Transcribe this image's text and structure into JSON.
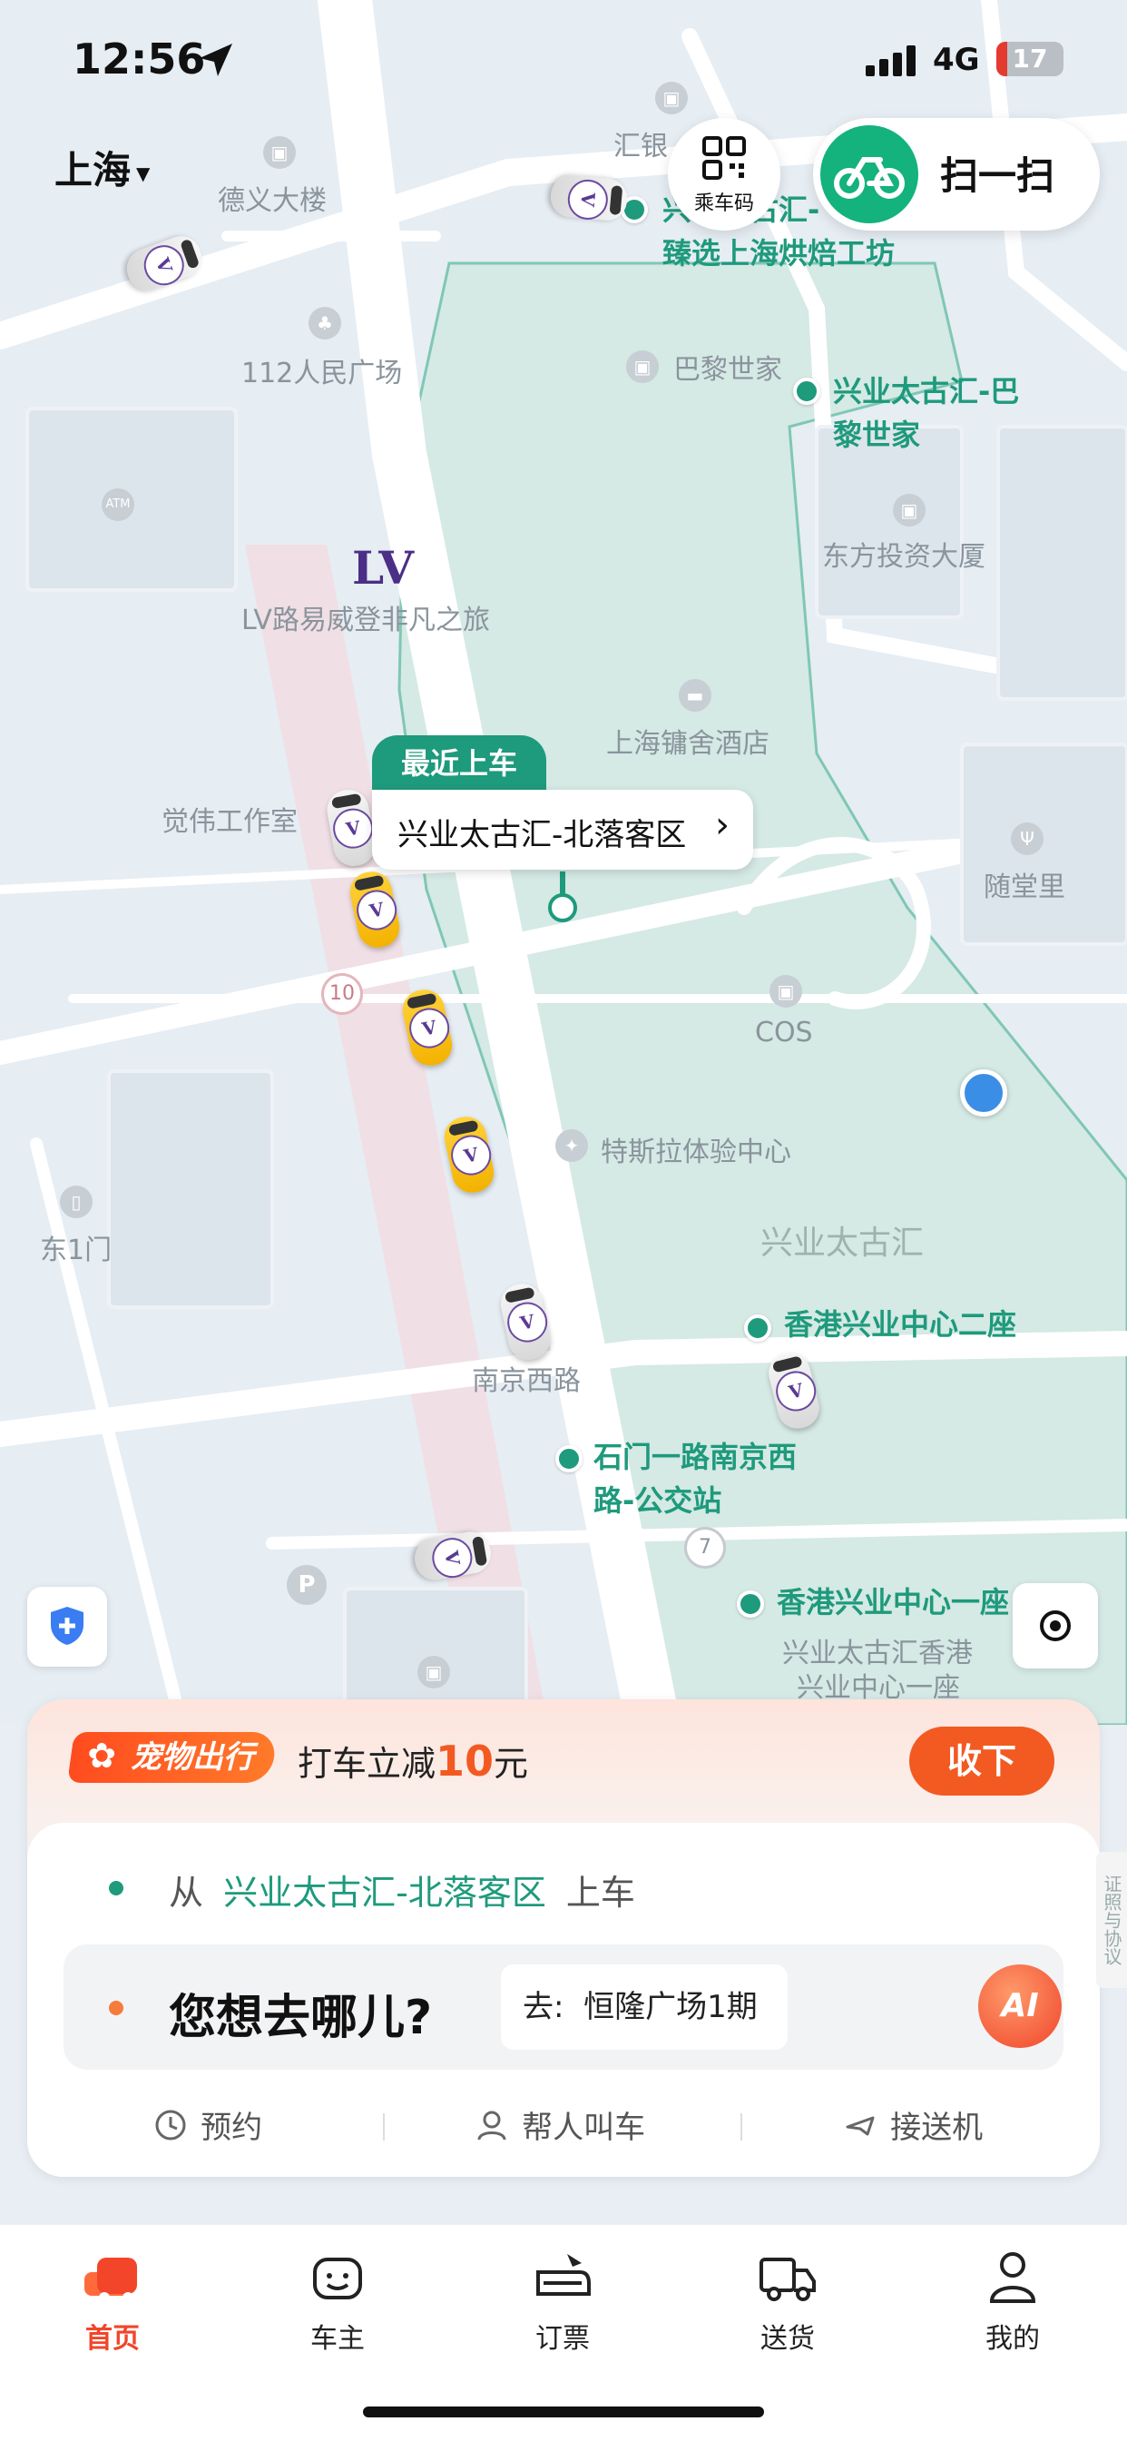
{
  "status_bar": {
    "time": "12:56",
    "network": "4G",
    "battery": "17"
  },
  "header": {
    "city": "上海",
    "qr_label": "乘车码",
    "scan_label": "扫一扫"
  },
  "map": {
    "pois": [
      {
        "name": "德义大楼"
      },
      {
        "name": "汇银"
      },
      {
        "name": "112人民广场"
      },
      {
        "name": "巴黎世家"
      },
      {
        "name": "东方投资大厦"
      },
      {
        "name": "LV路易威登非凡之旅"
      },
      {
        "name": "上海镛舍酒店"
      },
      {
        "name": "觉伟工作室"
      },
      {
        "name": "随堂里"
      },
      {
        "name": "COS"
      },
      {
        "name": "特斯拉体验中心"
      },
      {
        "name": "兴业太古汇"
      },
      {
        "name": "东1门"
      },
      {
        "name": "南京西路"
      },
      {
        "name": "兴业太古汇香港"
      },
      {
        "name": "兴业中心一座"
      }
    ],
    "green_pois": [
      {
        "name": "兴业太古汇-"
      },
      {
        "name": "臻选上海烘焙工坊"
      },
      {
        "name": "兴业太古汇-巴"
      },
      {
        "name": "黎世家"
      },
      {
        "name": "香港兴业中心二座"
      },
      {
        "name": "石门一路南京西"
      },
      {
        "name": "路-公交站"
      },
      {
        "name": "香港兴业中心一座"
      }
    ],
    "road_badges": [
      "10",
      "7"
    ],
    "pickup_tag": "最近上车",
    "pickup_name": "兴业太古汇-北落客区",
    "pickup_chevron": "›",
    "brand_logo": "LV"
  },
  "promo": {
    "badge": "宠物出行",
    "text_prefix": "打车立减",
    "amount": "10",
    "text_suffix": "元",
    "button": "收下"
  },
  "ride": {
    "from_prefix": "从",
    "from_place": "兴业太古汇-北落客区",
    "from_suffix": "上车",
    "dest_prompt": "您想去哪儿?",
    "suggest": "去:  恒隆广场1期",
    "ai_label": "AI",
    "side_tab": "证照与协议"
  },
  "quick": [
    {
      "label": "预约",
      "icon": "clock-icon"
    },
    {
      "label": "帮人叫车",
      "icon": "person-icon"
    },
    {
      "label": "接送机",
      "icon": "plane-icon"
    }
  ],
  "nav": [
    {
      "label": "首页",
      "icon": "home-car-icon",
      "active": true
    },
    {
      "label": "车主",
      "icon": "driver-face-icon",
      "active": false
    },
    {
      "label": "订票",
      "icon": "train-ticket-icon",
      "active": false
    },
    {
      "label": "送货",
      "icon": "truck-icon",
      "active": false
    },
    {
      "label": "我的",
      "icon": "profile-icon",
      "active": false
    }
  ],
  "colors": {
    "brand_green": "#1e9a7c",
    "accent_orange": "#f25a22",
    "map_bg": "#e6edf3",
    "park_green": "#d3e8e3"
  }
}
